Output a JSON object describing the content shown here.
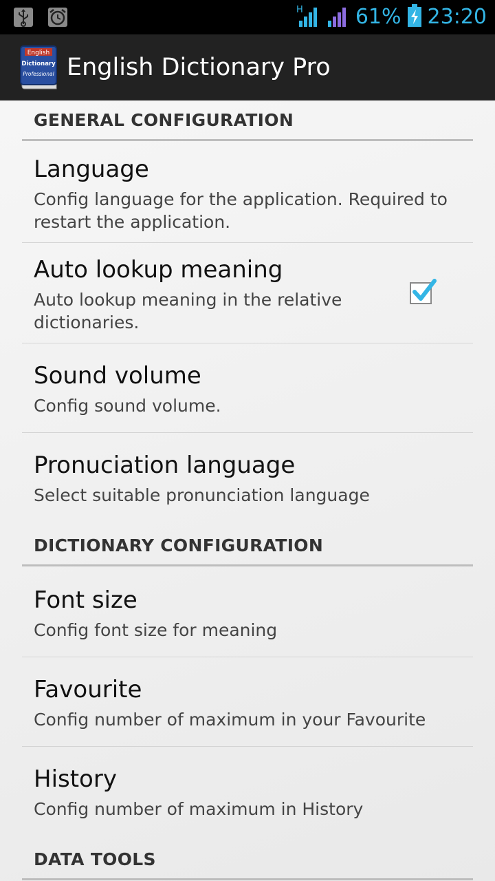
{
  "status_bar": {
    "battery_percent": "61%",
    "time": "23:20",
    "icons": [
      "usb-icon",
      "alarm-icon",
      "hspa-signal-icon",
      "signal-icon",
      "battery-charging-icon"
    ],
    "accent_color": "#33b5e5"
  },
  "action_bar": {
    "title": "English Dictionary Pro",
    "logo_text": [
      "English",
      "Dictionary",
      "Professional"
    ]
  },
  "sections": [
    {
      "title": "GENERAL CONFIGURATION",
      "items": [
        {
          "title": "Language",
          "summary": "Config language for the application. Required to restart the application."
        },
        {
          "title": "Auto lookup meaning",
          "summary": "Auto lookup meaning in the relative dictionaries.",
          "checked": true
        },
        {
          "title": "Sound volume",
          "summary": "Config sound volume."
        },
        {
          "title": "Pronuciation language",
          "summary": "Select suitable pronunciation language"
        }
      ]
    },
    {
      "title": "DICTIONARY CONFIGURATION",
      "items": [
        {
          "title": "Font size",
          "summary": "Config font size for meaning"
        },
        {
          "title": "Favourite",
          "summary": "Config number of maximum in your Favourite"
        },
        {
          "title": "History",
          "summary": "Config number of maximum in History"
        }
      ]
    },
    {
      "title": "DATA TOOLS",
      "items": []
    }
  ]
}
